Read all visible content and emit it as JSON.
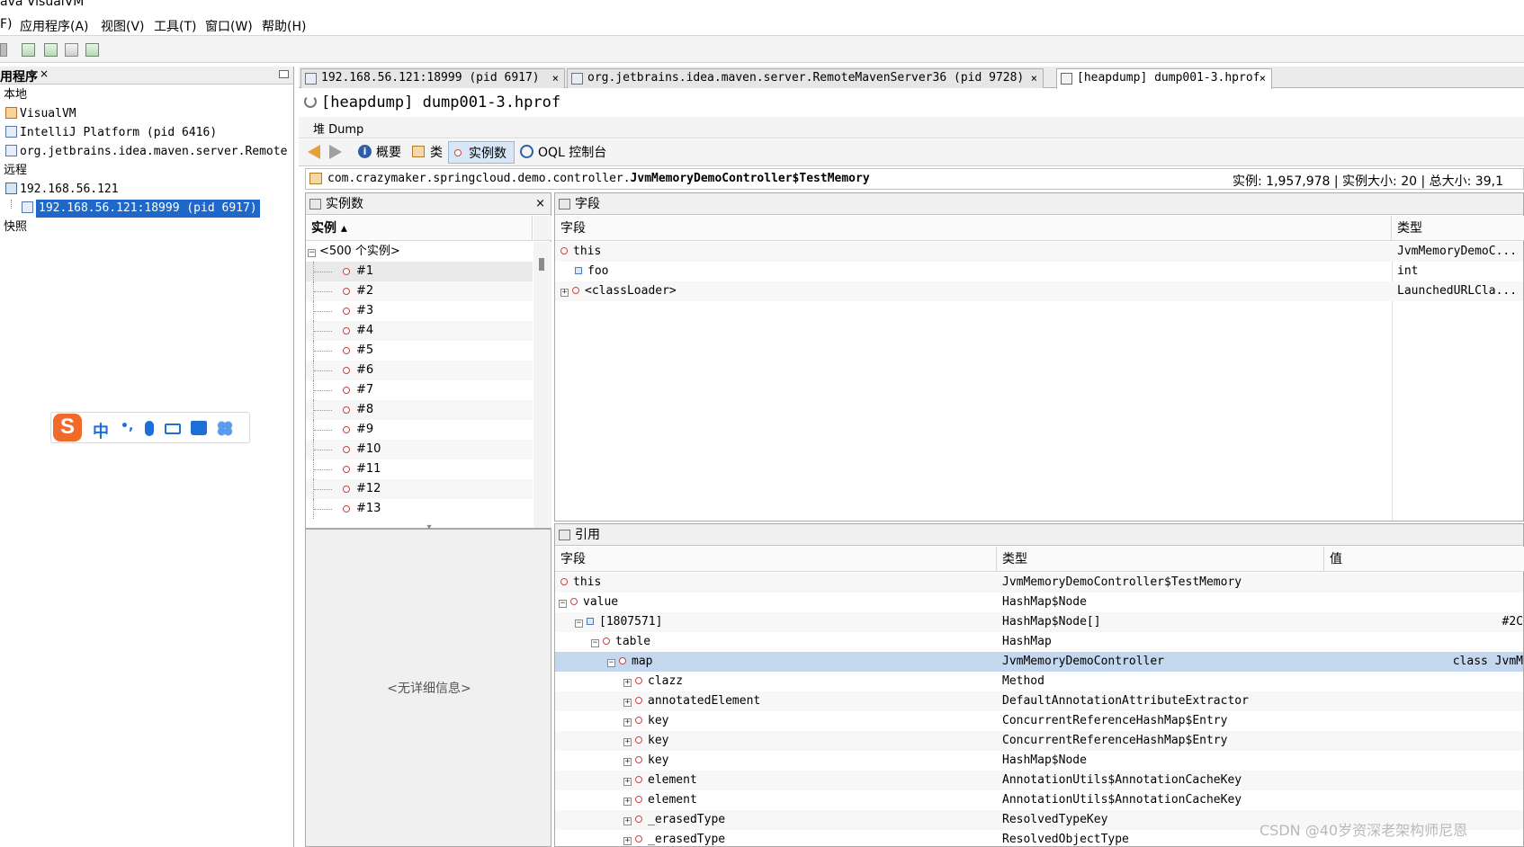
{
  "window": {
    "title": "ava VisualVM"
  },
  "menu": [
    "F)",
    "应用程序(A)",
    "视图(V)",
    "工具(T)",
    "窗口(W)",
    "帮助(H)"
  ],
  "toolbar": {
    "icons": [
      "open-icon",
      "add-remote-host-icon",
      "add-jmx-icon",
      "add-snapshot-icon",
      "add-coredump-icon"
    ]
  },
  "left": {
    "header": "用程序",
    "header_close": "×",
    "local_label": "本地",
    "items_local": [
      "VisualVM",
      "IntelliJ Platform (pid 6416)",
      "org.jetbrains.idea.maven.server.Remote"
    ],
    "remote_label": "远程",
    "remote_host": "192.168.56.121",
    "remote_app": "192.168.56.121:18999 (pid 6917)",
    "snapshots_label": "快照"
  },
  "tabs": [
    {
      "label": "192.168.56.121:18999 (pid 6917)",
      "close": "×"
    },
    {
      "label": "org.jetbrains.idea.maven.server.RemoteMavenServer36 (pid 9728)",
      "close": "×"
    },
    {
      "label": "[heapdump] dump001-3.hprof",
      "close": "×"
    }
  ],
  "doc": {
    "title": "[heapdump] dump001-3.hprof",
    "dump_label": "堆 Dump"
  },
  "views": {
    "summary": "概要",
    "classes": "类",
    "instances": "实例数",
    "oql": "OQL 控制台"
  },
  "path": {
    "prefix": "com.crazymaker.springcloud.demo.controller.",
    "classname": "JvmMemoryDemoController$TestMemory",
    "stats": "实例: 1,957,978 | 实例大小: 20 | 总大小: 39,1"
  },
  "instances": {
    "title": "实例数",
    "close": "×",
    "column": "实例 ▴",
    "group": "<500 个实例>",
    "items": [
      "#1",
      "#2",
      "#3",
      "#4",
      "#5",
      "#6",
      "#7",
      "#8",
      "#9",
      "#10",
      "#11",
      "#12",
      "#13"
    ],
    "no_details": "<无详细信息>"
  },
  "fields": {
    "title": "字段",
    "col_field": "字段",
    "col_type": "类型",
    "rows": [
      {
        "name": "this",
        "type": "JvmMemoryDemoC..."
      },
      {
        "name": "foo",
        "type": "int"
      },
      {
        "name": "<classLoader>",
        "type": "LaunchedURLCla..."
      }
    ]
  },
  "references": {
    "title": "引用",
    "col_field": "字段",
    "col_type": "类型",
    "col_value": "值",
    "rows": [
      {
        "name": "this",
        "type": "JvmMemoryDemoController$TestMemory",
        "value": ""
      },
      {
        "name": "value",
        "type": "HashMap$Node",
        "value": ""
      },
      {
        "name": "[1807571]",
        "type": "HashMap$Node[]",
        "value": "#2C"
      },
      {
        "name": "table",
        "type": "HashMap",
        "value": ""
      },
      {
        "name": "map",
        "type": "JvmMemoryDemoController",
        "value": "class JvmM"
      },
      {
        "name": "clazz",
        "type": "Method",
        "value": ""
      },
      {
        "name": "annotatedElement",
        "type": "DefaultAnnotationAttributeExtractor",
        "value": ""
      },
      {
        "name": "key",
        "type": "ConcurrentReferenceHashMap$Entry",
        "value": ""
      },
      {
        "name": "key",
        "type": "ConcurrentReferenceHashMap$Entry",
        "value": ""
      },
      {
        "name": "key",
        "type": "HashMap$Node",
        "value": ""
      },
      {
        "name": "element",
        "type": "AnnotationUtils$AnnotationCacheKey",
        "value": ""
      },
      {
        "name": "element",
        "type": "AnnotationUtils$AnnotationCacheKey",
        "value": ""
      },
      {
        "name": "_erasedType",
        "type": "ResolvedTypeKey",
        "value": ""
      },
      {
        "name": "_erasedType",
        "type": "ResolvedObjectType",
        "value": ""
      }
    ]
  },
  "ime": {
    "chinese": "中",
    "punct": "•,"
  },
  "watermark": "CSDN @40岁资深老架构师尼恩"
}
